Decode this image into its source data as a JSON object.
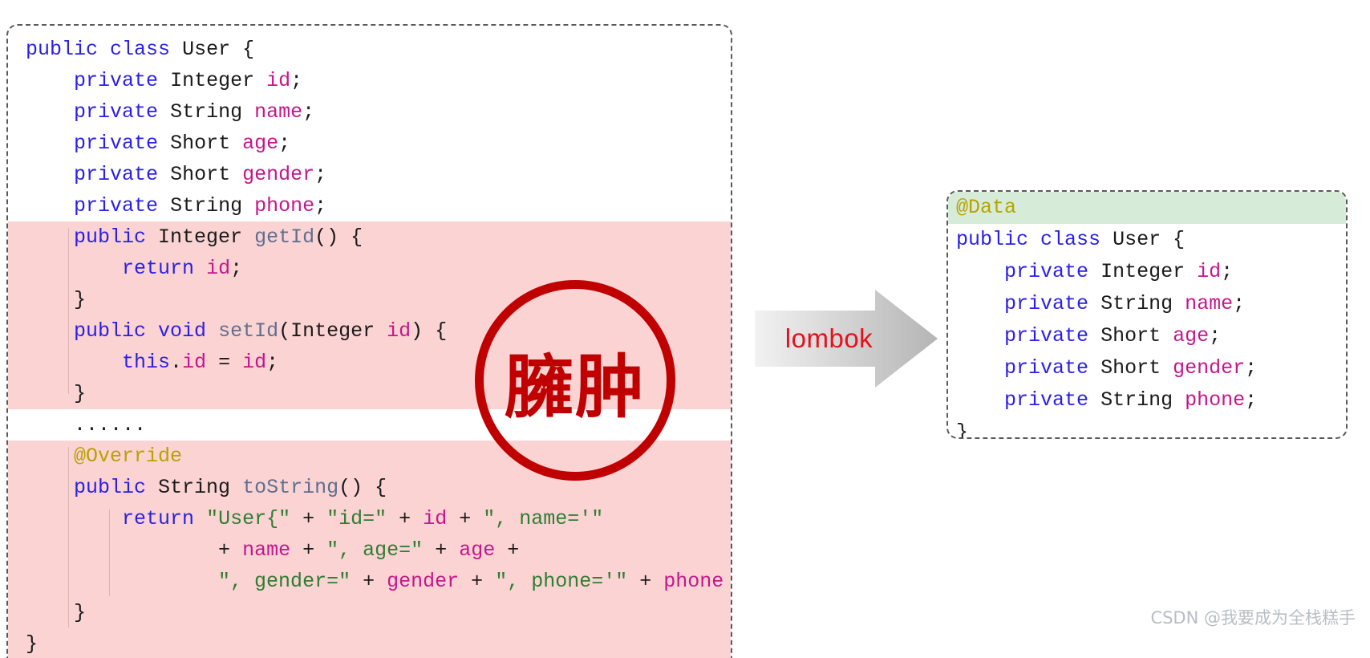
{
  "colors": {
    "highlight_pink": "#fbd3d3",
    "highlight_green": "#d6ecd9",
    "stamp_red": "#c00000",
    "lombok_red": "#e8101b",
    "panel_border": "#5a5a5a",
    "keyword_blue": "#2a1fe8",
    "variable_magenta": "#c5168c",
    "string_green": "#2e7d32",
    "annotation_gold": "#b8a200",
    "method_slate": "#5f6f8f",
    "watermark_gray": "#b9bec5"
  },
  "left_panel": {
    "name": "verbose-user-class",
    "lines": [
      {
        "text": "public class User {",
        "indent": 0,
        "highlight": false
      },
      {
        "text": "    private Integer id;",
        "indent": 1,
        "highlight": false
      },
      {
        "text": "    private String name;",
        "indent": 1,
        "highlight": false
      },
      {
        "text": "    private Short age;",
        "indent": 1,
        "highlight": false
      },
      {
        "text": "    private Short gender;",
        "indent": 1,
        "highlight": false
      },
      {
        "text": "    private String phone;",
        "indent": 1,
        "highlight": false
      },
      {
        "text": "    public Integer getId() {",
        "indent": 1,
        "highlight": true
      },
      {
        "text": "        return id;",
        "indent": 2,
        "highlight": true
      },
      {
        "text": "    }",
        "indent": 1,
        "highlight": true
      },
      {
        "text": "    public void setId(Integer id) {",
        "indent": 1,
        "highlight": true
      },
      {
        "text": "        this.id = id;",
        "indent": 2,
        "highlight": true
      },
      {
        "text": "    }",
        "indent": 1,
        "highlight": true
      },
      {
        "text": "    ......",
        "indent": 1,
        "highlight": false
      },
      {
        "text": "    @Override",
        "indent": 1,
        "highlight": true
      },
      {
        "text": "    public String toString() {",
        "indent": 1,
        "highlight": true
      },
      {
        "text": "        return \"User{\" + \"id=\" + id + \", name='\"",
        "indent": 2,
        "highlight": true
      },
      {
        "text": "                + name + \", age=\" + age +",
        "indent": 3,
        "highlight": true
      },
      {
        "text": "                \", gender=\" + gender + \", phone='\" + phone + '}';",
        "indent": 3,
        "highlight": true
      },
      {
        "text": "    }",
        "indent": 1,
        "highlight": true
      },
      {
        "text": "}",
        "indent": 0,
        "highlight": true
      }
    ]
  },
  "right_panel": {
    "name": "lombok-user-class",
    "lines": [
      {
        "text": "@Data",
        "highlight": true
      },
      {
        "text": "public class User {",
        "highlight": false
      },
      {
        "text": "    private Integer id;",
        "highlight": false
      },
      {
        "text": "    private String name;",
        "highlight": false
      },
      {
        "text": "    private Short age;",
        "highlight": false
      },
      {
        "text": "    private Short gender;",
        "highlight": false
      },
      {
        "text": "    private String phone;",
        "highlight": false
      },
      {
        "text": "}",
        "highlight": false
      }
    ]
  },
  "arrow": {
    "label": "lombok"
  },
  "stamp": {
    "text": "臃肿"
  },
  "watermark": {
    "text": "CSDN @我要成为全栈糕手"
  }
}
